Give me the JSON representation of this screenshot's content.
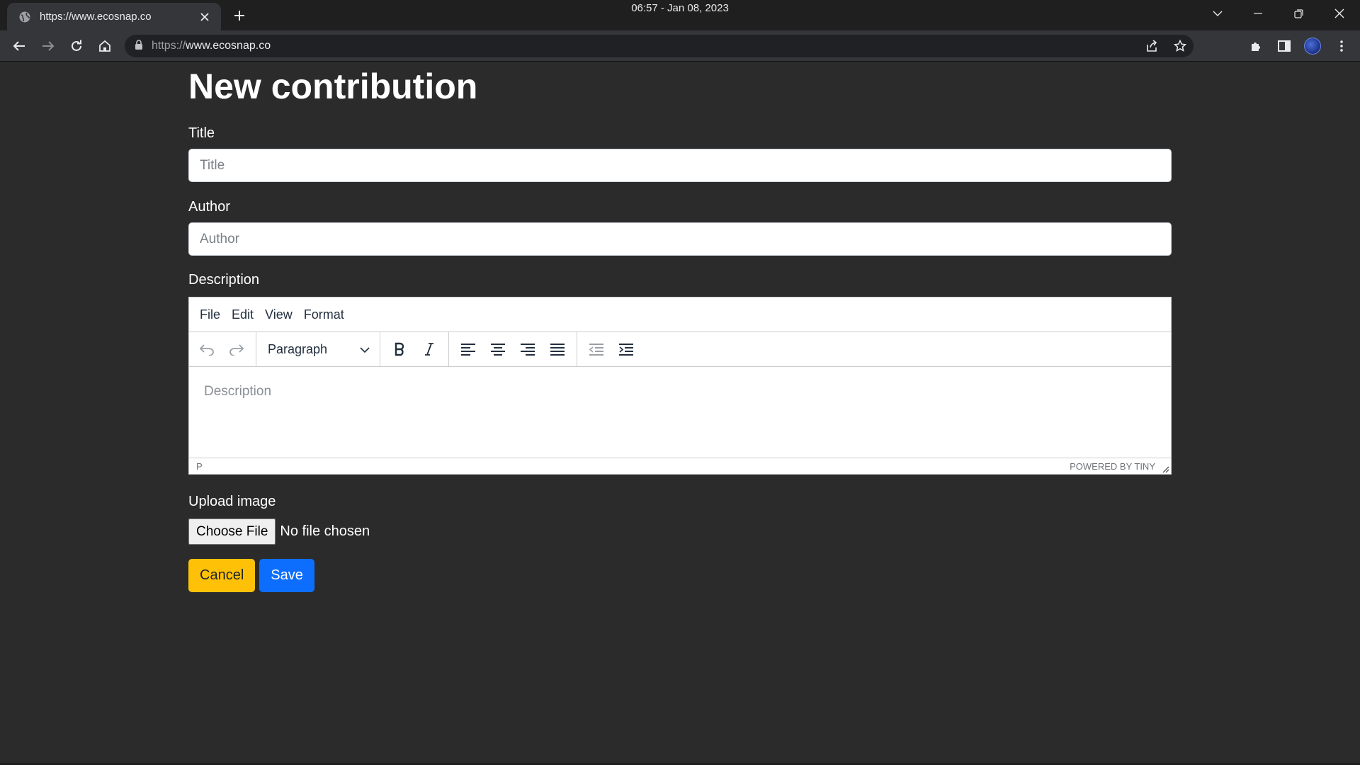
{
  "browser": {
    "tab_title": "https://www.ecosnap.co",
    "clock": "06:57 - Jan 08, 2023",
    "url_scheme": "https://",
    "url_host": "www.ecosnap.co",
    "icons": [
      "globe-icon",
      "close-icon",
      "plus-icon",
      "chevron-down-icon",
      "minimize-icon",
      "restore-icon",
      "back-arrow-icon",
      "forward-arrow-icon",
      "reload-icon",
      "home-icon",
      "lock-icon",
      "share-icon",
      "star-icon",
      "puzzle-icon",
      "sidepanel-icon",
      "avatar",
      "kebab-menu-icon"
    ]
  },
  "page": {
    "heading": "New contribution",
    "title_label": "Title",
    "title_placeholder": "Title",
    "author_label": "Author",
    "author_placeholder": "Author",
    "description_label": "Description",
    "editor": {
      "menus": [
        "File",
        "Edit",
        "View",
        "Format"
      ],
      "block_format": "Paragraph",
      "placeholder": "Description",
      "path": "P",
      "branding": "POWERED BY TINY",
      "toolbar_icons": [
        "undo-icon",
        "redo-icon",
        "bold-icon",
        "italic-icon",
        "align-left-icon",
        "align-center-icon",
        "align-right-icon",
        "align-justify-icon",
        "outdent-icon",
        "indent-icon"
      ]
    },
    "upload_label": "Upload image",
    "choose_file": "Choose File",
    "no_file": "No file chosen",
    "cancel": "Cancel",
    "save": "Save"
  },
  "colors": {
    "page_bg": "#2b2b2b",
    "cancel_bg": "#ffc107",
    "save_bg": "#0d6efd"
  }
}
